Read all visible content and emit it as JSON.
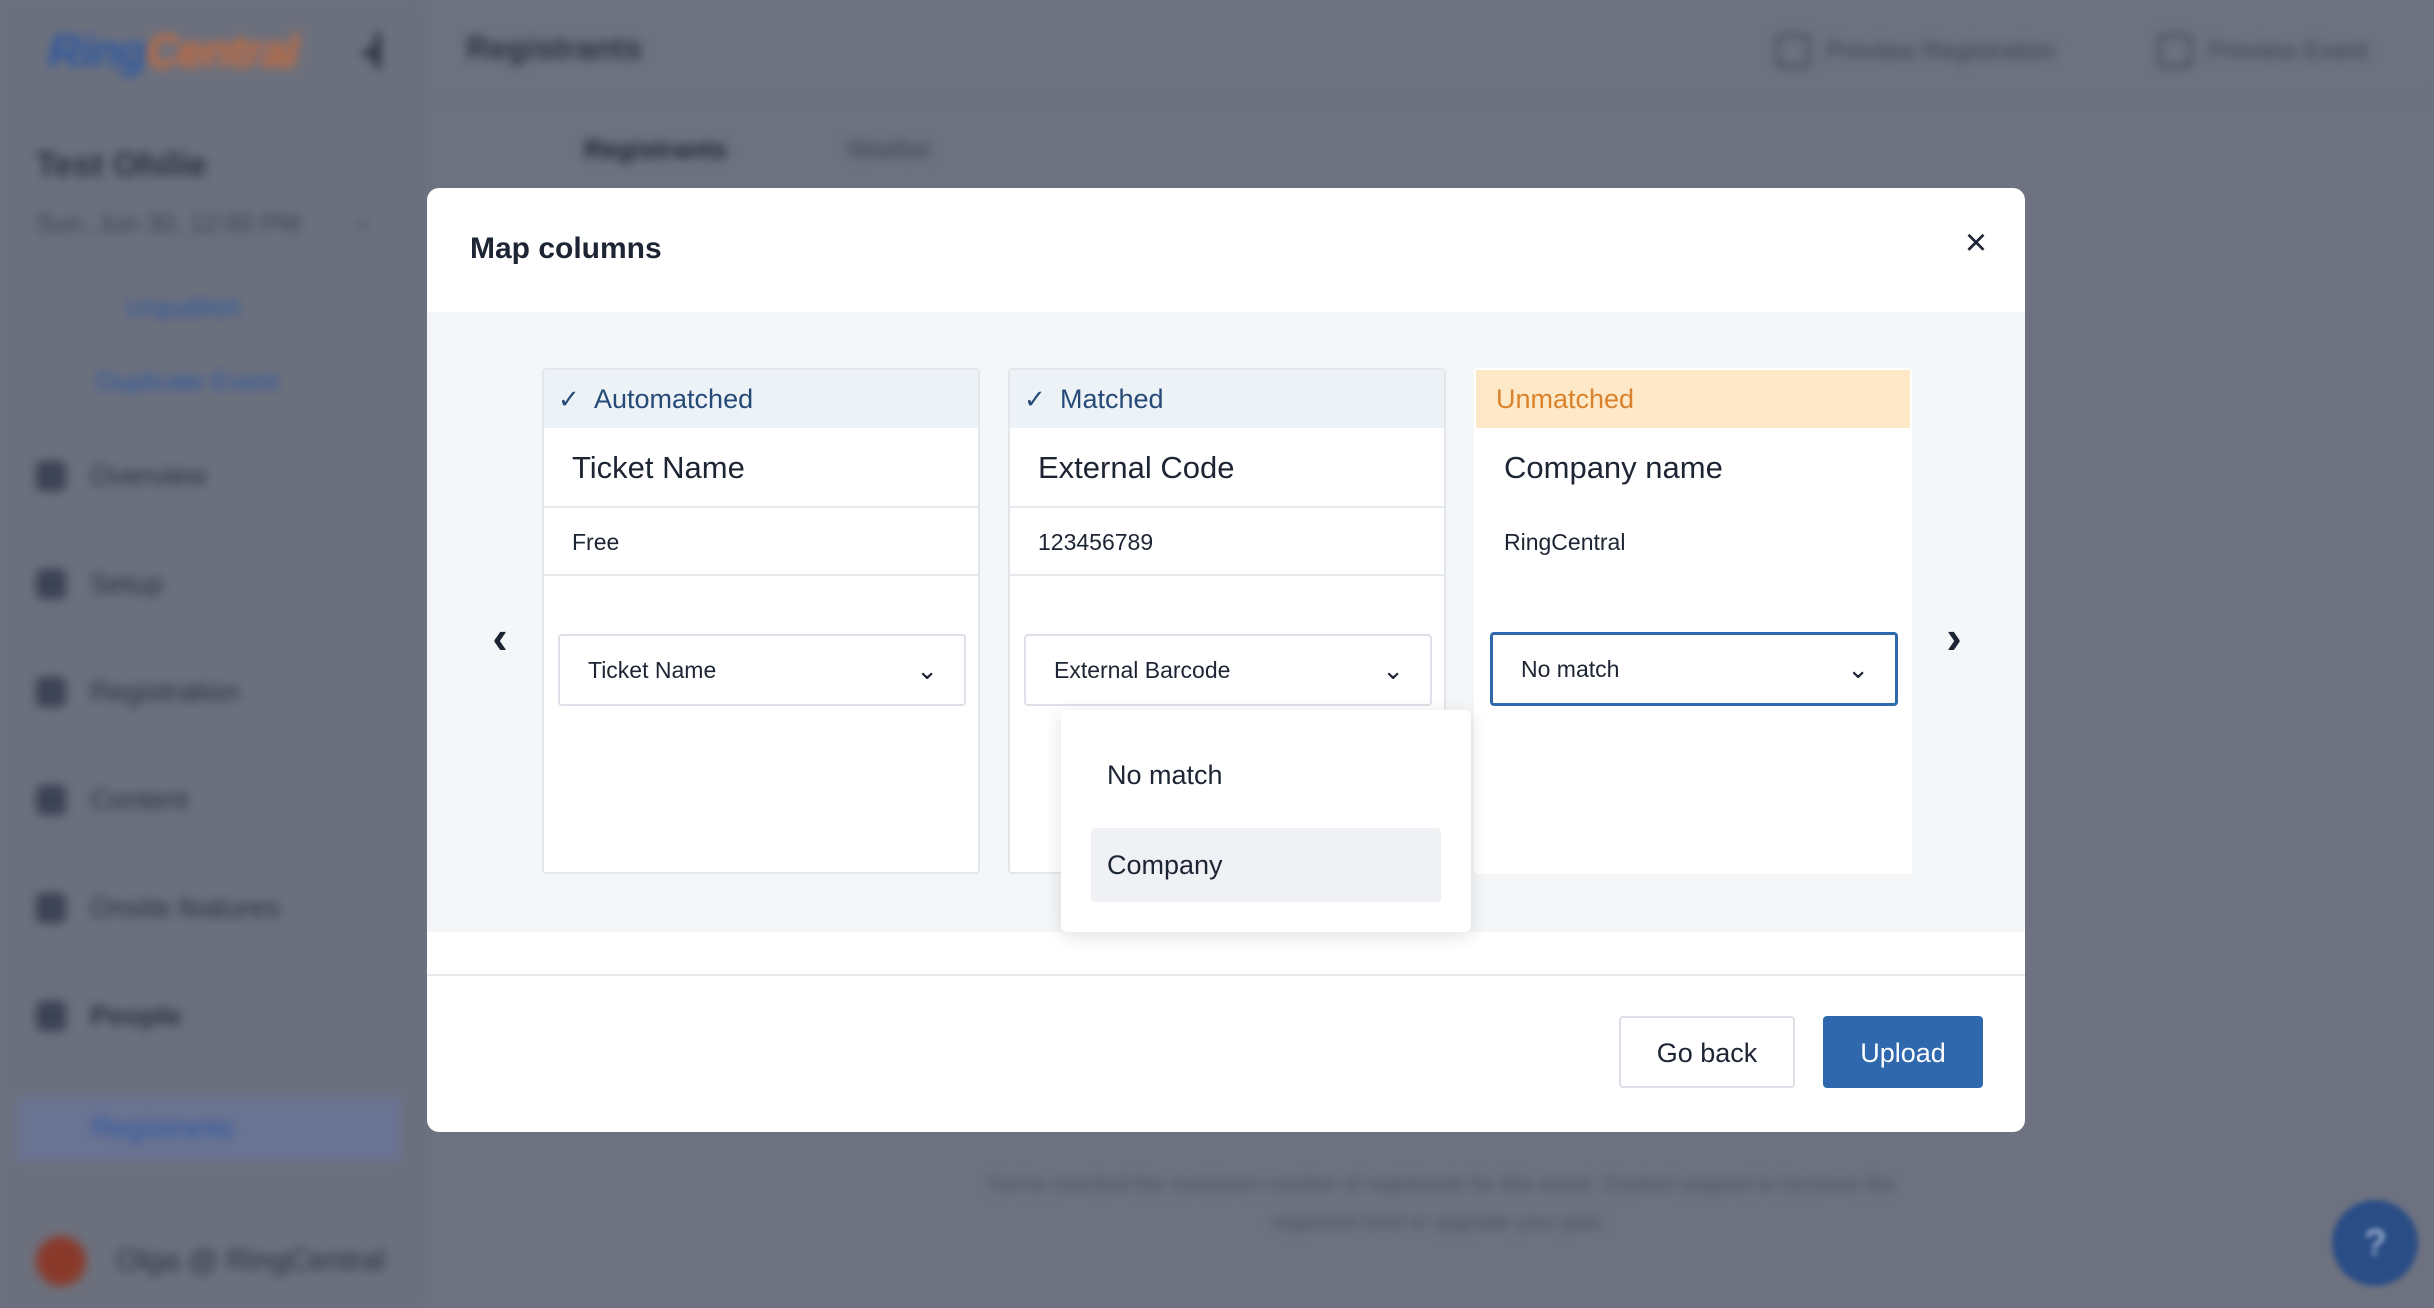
{
  "app": {
    "logo_ring": "Ring",
    "logo_central": "Central",
    "page_title": "Registrants",
    "preview_registration": "Preview Registration",
    "preview_event": "Preview Event",
    "event_name": "Test Ohilie",
    "event_date": "Sun, Jun 30, 12:00 PM",
    "unpublish": "Unpublish",
    "duplicate_event": "Duplicate Event",
    "nav": [
      "Overview",
      "Setup",
      "Registration",
      "Content",
      "Onsite features",
      "People"
    ],
    "nav_active": "Registrants",
    "user": "Olga @ RingCentral",
    "tabs": [
      "Registrants",
      "Waitlist"
    ],
    "bottom_text": "You've reached the maximum number of registrants for this event. Contact support to increase the registrant limit or upgrade your plan."
  },
  "modal": {
    "title": "Map columns",
    "close_icon": "×",
    "prev_icon": "‹",
    "next_icon": "›",
    "columns": [
      {
        "status": "Automatched",
        "name": "Ticket Name",
        "sample": "Free",
        "selected": "Ticket Name"
      },
      {
        "status": "Matched",
        "name": "External Code",
        "sample": "123456789",
        "selected": "External Barcode"
      },
      {
        "status": "Unmatched",
        "name": "Company name",
        "sample": "RingCentral",
        "selected": "No match"
      }
    ],
    "dropdown_options": [
      "No match",
      "Company"
    ],
    "dropdown_highlighted": "Company",
    "go_back": "Go back",
    "upload": "Upload"
  },
  "colors": {
    "primary": "#2f68ad",
    "matched_bg": "#edf2f7",
    "unmatched_bg": "#fde8c8",
    "unmatched_text": "#d9822b"
  }
}
